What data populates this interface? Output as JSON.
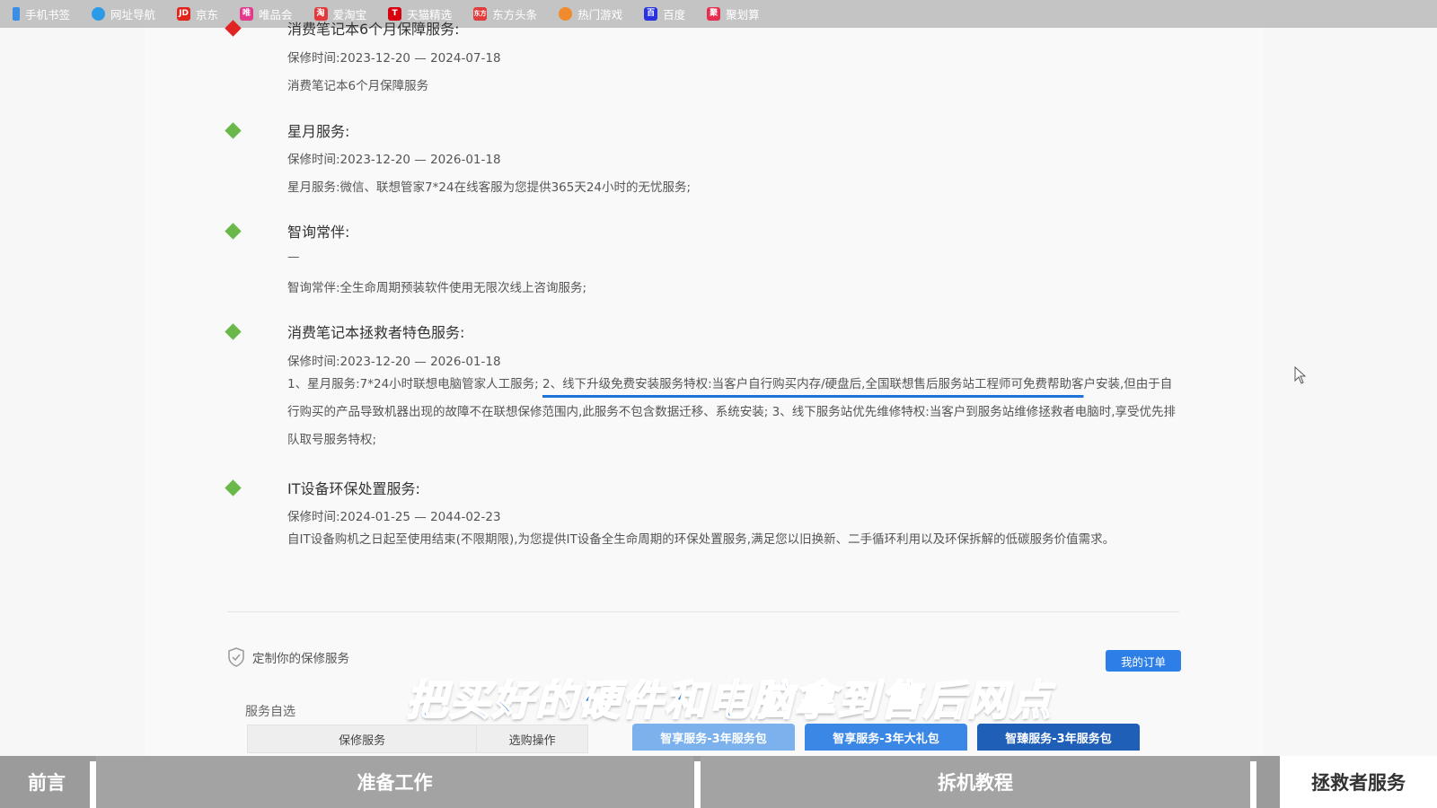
{
  "bookmarks": [
    {
      "label": "手机书签",
      "icon": "bookmark-icon",
      "color": "#3a8ee6",
      "glyph": ""
    },
    {
      "label": "网址导航",
      "icon": "globe-icon",
      "color": "#2b9be8",
      "glyph": ""
    },
    {
      "label": "京东",
      "icon": "jd-icon",
      "color": "#e1251b",
      "glyph": "JD"
    },
    {
      "label": "唯品会",
      "icon": "vip-icon",
      "color": "#e43a8c",
      "glyph": "唯"
    },
    {
      "label": "爱淘宝",
      "icon": "taobao-icon",
      "color": "#e4393c",
      "glyph": "淘"
    },
    {
      "label": "天猫精选",
      "icon": "tmall-icon",
      "color": "#d7000f",
      "glyph": "T"
    },
    {
      "label": "东方头条",
      "icon": "news-icon",
      "color": "#e23b3b",
      "glyph": "东方"
    },
    {
      "label": "热门游戏",
      "icon": "game-icon",
      "color": "#f08a2c",
      "glyph": ""
    },
    {
      "label": "百度",
      "icon": "baidu-icon",
      "color": "#2932e1",
      "glyph": "百"
    },
    {
      "label": "聚划算",
      "icon": "juhuasuan-icon",
      "color": "#e62d4f",
      "glyph": "聚"
    }
  ],
  "services": [
    {
      "title": "消费笔记本6个月保障服务:",
      "warranty": "保修时间:2023-12-20 — 2024-07-18",
      "desc": "消费笔记本6个月保障服务",
      "marker": "red"
    },
    {
      "title": "星月服务:",
      "warranty": "保修时间:2023-12-20 — 2026-01-18",
      "desc": "星月服务:微信、联想管家7*24在线客服为您提供365天24小时的无忧服务;",
      "marker": "green"
    },
    {
      "title": "智询常伴:",
      "warranty": "—",
      "desc": "智询常伴:全生命周期预装软件使用无限次线上咨询服务;",
      "marker": "green"
    },
    {
      "title": "消费笔记本拯救者特色服务:",
      "warranty": "保修时间:2023-12-20 — 2026-01-18",
      "desc_a": "1、星月服务:7*24小时联想电脑管家人工服务; ",
      "desc_b": "2、线下升级免费安装服务特权:当客户自行购买内存/硬盘后,全国联想售后服务站工程师可免费帮助客",
      "desc_c": "户安装,但由于自行购买的产品导致机器出现的故障不在联想保修范围内,此服务不包含数据迁移、系统安装; 3、线下服务站优先维修特权:当客户到服务站维修拯救者电脑时,享受优先排队取号服务特权;",
      "marker": "green"
    },
    {
      "title": "IT设备环保处置服务:",
      "warranty": "保修时间:2024-01-25 — 2044-02-23",
      "desc": "自IT设备购机之日起至使用结束(不限期限),为您提供IT设备全生命周期的环保处置服务,满足您以旧换新、二手循环利用以及环保拆解的低碳服务价值需求。",
      "marker": "green"
    }
  ],
  "custom": {
    "title": "定制你的保修服务",
    "orders_button": "我的订单",
    "self_select": "服务自选",
    "table_headers": [
      "保修服务",
      "选购操作"
    ],
    "packages": [
      "智享服务-3年服务包",
      "智享服务-3年大礼包",
      "智臻服务-3年服务包"
    ]
  },
  "subtitle": "把买好的硬件和电脑拿到售后网点",
  "chapters": [
    "前言",
    "准备工作",
    "拆机教程",
    "拯救者服务"
  ],
  "colors": {
    "accent": "#2d7ee6",
    "marker_green": "#6bb84a",
    "marker_red": "#e02424",
    "underline": "#1f73d8"
  }
}
